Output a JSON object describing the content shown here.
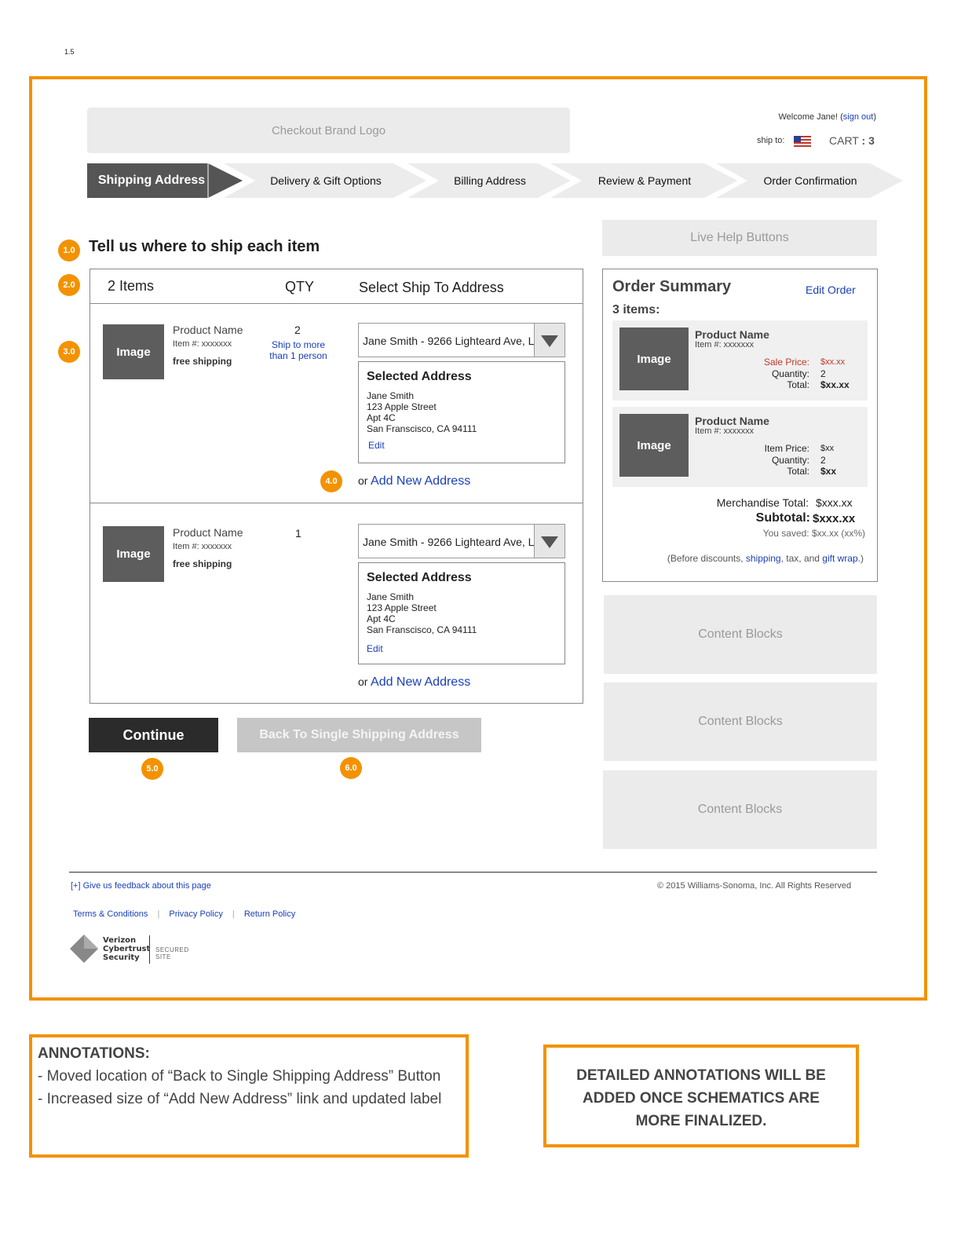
{
  "page_label": "1.5",
  "header": {
    "logo_text": "Checkout Brand Logo",
    "welcome_prefix": "Welcome Jane! (",
    "sign_out": "sign out",
    "welcome_suffix": ")",
    "ship_to_label": "ship to:",
    "cart_label": "CART",
    "cart_sep": ":",
    "cart_count": "3"
  },
  "steps": [
    {
      "label": "Shipping Address",
      "active": true
    },
    {
      "label": "Delivery & Gift Options",
      "active": false
    },
    {
      "label": "Billing Address",
      "active": false
    },
    {
      "label": "Review & Payment",
      "active": false
    },
    {
      "label": "Order Confirmation",
      "active": false
    }
  ],
  "badges": [
    "1.0",
    "2.0",
    "3.0",
    "4.0",
    "5.0",
    "6.0"
  ],
  "main": {
    "title": "Tell us where to ship each item",
    "table_headers": {
      "items": "2 Items",
      "qty": "QTY",
      "address": "Select Ship To Address"
    },
    "items": [
      {
        "image_label": "Image",
        "name": "Product Name",
        "item_no": "Item #: xxxxxxx",
        "shipping": "free shipping",
        "qty": "2",
        "ship_more_line1": "Ship to more",
        "ship_more_line2": "than 1 person",
        "dropdown_value": "Jane Smith - 9266 Lighteard Ave, L",
        "selected_title": "Selected Address",
        "address_lines": [
          "Jane Smith",
          "123 Apple Street",
          "Apt 4C",
          "San Franscisco, CA 94111"
        ],
        "edit": "Edit",
        "or": "or",
        "add_new": "Add New Address"
      },
      {
        "image_label": "Image",
        "name": "Product Name",
        "item_no": "Item #: xxxxxxx",
        "shipping": "free shipping",
        "qty": "1",
        "dropdown_value": "Jane Smith - 9266 Lighteard Ave, L",
        "selected_title": "Selected Address",
        "address_lines": [
          "Jane Smith",
          "123 Apple Street",
          "Apt 4C",
          "San Franscisco, CA 94111"
        ],
        "edit": "Edit",
        "or": "or",
        "add_new": "Add New Address"
      }
    ],
    "continue_label": "Continue",
    "back_label": "Back To Single Shipping Address"
  },
  "sidebar": {
    "live_help": "Live Help Buttons",
    "summary_title": "Order Summary",
    "edit_order": "Edit Order",
    "items_count": "3 items:",
    "items": [
      {
        "image_label": "Image",
        "name": "Product Name",
        "item_no": "Item #: xxxxxxx",
        "price_label": "Sale Price:",
        "price": "$xx.xx",
        "qty_label": "Quantity:",
        "qty": "2",
        "total_label": "Total:",
        "total": "$xx.xx"
      },
      {
        "image_label": "Image",
        "name": "Product Name",
        "item_no": "Item #: xxxxxxx",
        "price_label": "Item Price:",
        "price": "$xx",
        "qty_label": "Quantity:",
        "qty": "2",
        "total_label": "Total:",
        "total": "$xx"
      }
    ],
    "merch_label": "Merchandise Total:",
    "merch_value": "$xxx.xx",
    "subtotal_label": "Subtotal:",
    "subtotal_value": "$xxx.xx",
    "saved_label": "You saved:",
    "saved_value": "$xx.xx (xx%)",
    "note_prefix": "(Before discounts, ",
    "note_shipping": "shipping",
    "note_mid": ", tax, and ",
    "note_gift": "gift wrap",
    "note_suffix": ".)",
    "content_blocks": [
      "Content Blocks",
      "Content Blocks",
      "Content Blocks"
    ]
  },
  "footer": {
    "feedback": "[+] Give us feedback about this page",
    "copyright": "© 2015 Williams-Sonoma, Inc. All Rights Reserved",
    "links": [
      "Terms & Conditions",
      "Privacy Policy",
      "Return Policy"
    ],
    "seal_line1": "Verizon",
    "seal_line2": "Cybertrust",
    "seal_line3": "Security",
    "seal_secured": "SECURED SITE"
  },
  "annotations": {
    "title": "ANNOTATIONS:",
    "lines": [
      "- Moved location of “Back to Single Shipping Address” Button",
      "- Increased size of “Add New Address” link and updated label"
    ],
    "detailed": "DETAILED ANNOTATIONS WILL BE ADDED ONCE SCHEMATICS ARE MORE FINALIZED."
  },
  "colors": {
    "accent": "#f39200",
    "link": "#1a3fb5",
    "sale": "#c0392b",
    "active_step": "#555555",
    "inactive_step": "#ececec"
  }
}
